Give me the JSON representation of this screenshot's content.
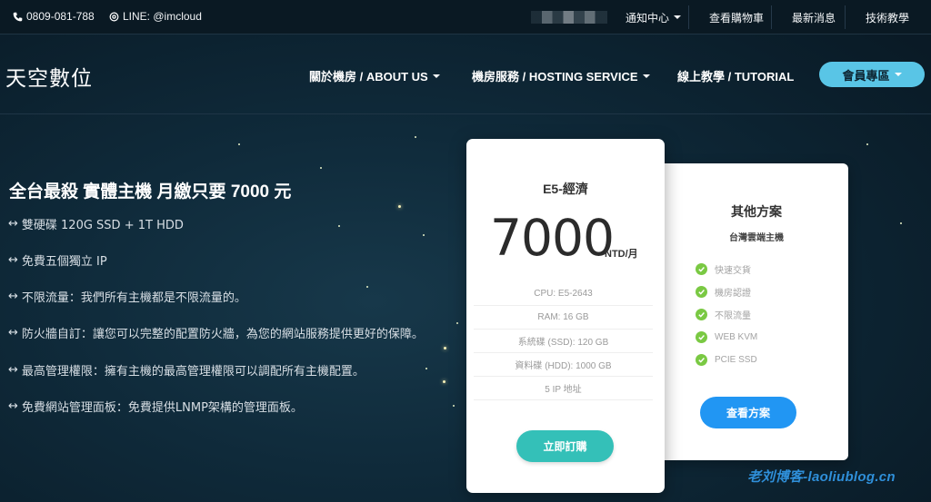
{
  "topbar": {
    "phone": "0809-081-788",
    "line": "LINE: @imcloud",
    "links": [
      "通知中心",
      "查看購物車",
      "最新消息",
      "技術教學"
    ]
  },
  "nav": {
    "brand": "天空數位",
    "items": [
      "關於機房 / ABOUT US",
      "機房服務 / HOSTING SERVICE",
      "線上教學 / TUTORIAL"
    ],
    "member_button": "會員專區"
  },
  "hero": {
    "title": "全台最殺 實體主機 月繳只要 7000 元",
    "features": [
      "雙硬碟 120G SSD + 1T HDD",
      "免費五個獨立 IP",
      "不限流量：我們所有主機都是不限流量的。",
      "防火牆自訂：讓您可以完整的配置防火牆，為您的網站服務提供更好的保障。",
      "最高管理權限：擁有主機的最高管理權限可以調配所有主機配置。",
      "免費網站管理面板：免費提供LNMP架構的管理面板。"
    ]
  },
  "plan_card": {
    "name": "E5-經濟",
    "price": "7000",
    "unit": "NTD/月",
    "specs": [
      "CPU: E5-2643",
      "RAM: 16 GB",
      "系統碟 (SSD): 120 GB",
      "資料碟 (HDD): 1000 GB",
      "5 IP 地址"
    ],
    "button": "立即訂購"
  },
  "other_card": {
    "title": "其他方案",
    "subtitle": "台灣雲端主機",
    "features": [
      "快速交貨",
      "機房認證",
      "不限流量",
      "WEB KVM",
      "PCIE SSD"
    ],
    "button": "查看方案"
  },
  "watermark": "老刘博客-laoliublog.cn",
  "colors": {
    "member_button": "#59c5e6",
    "order_button": "#34c0b8",
    "view_button": "#2196f3",
    "check": "#7ac943"
  }
}
